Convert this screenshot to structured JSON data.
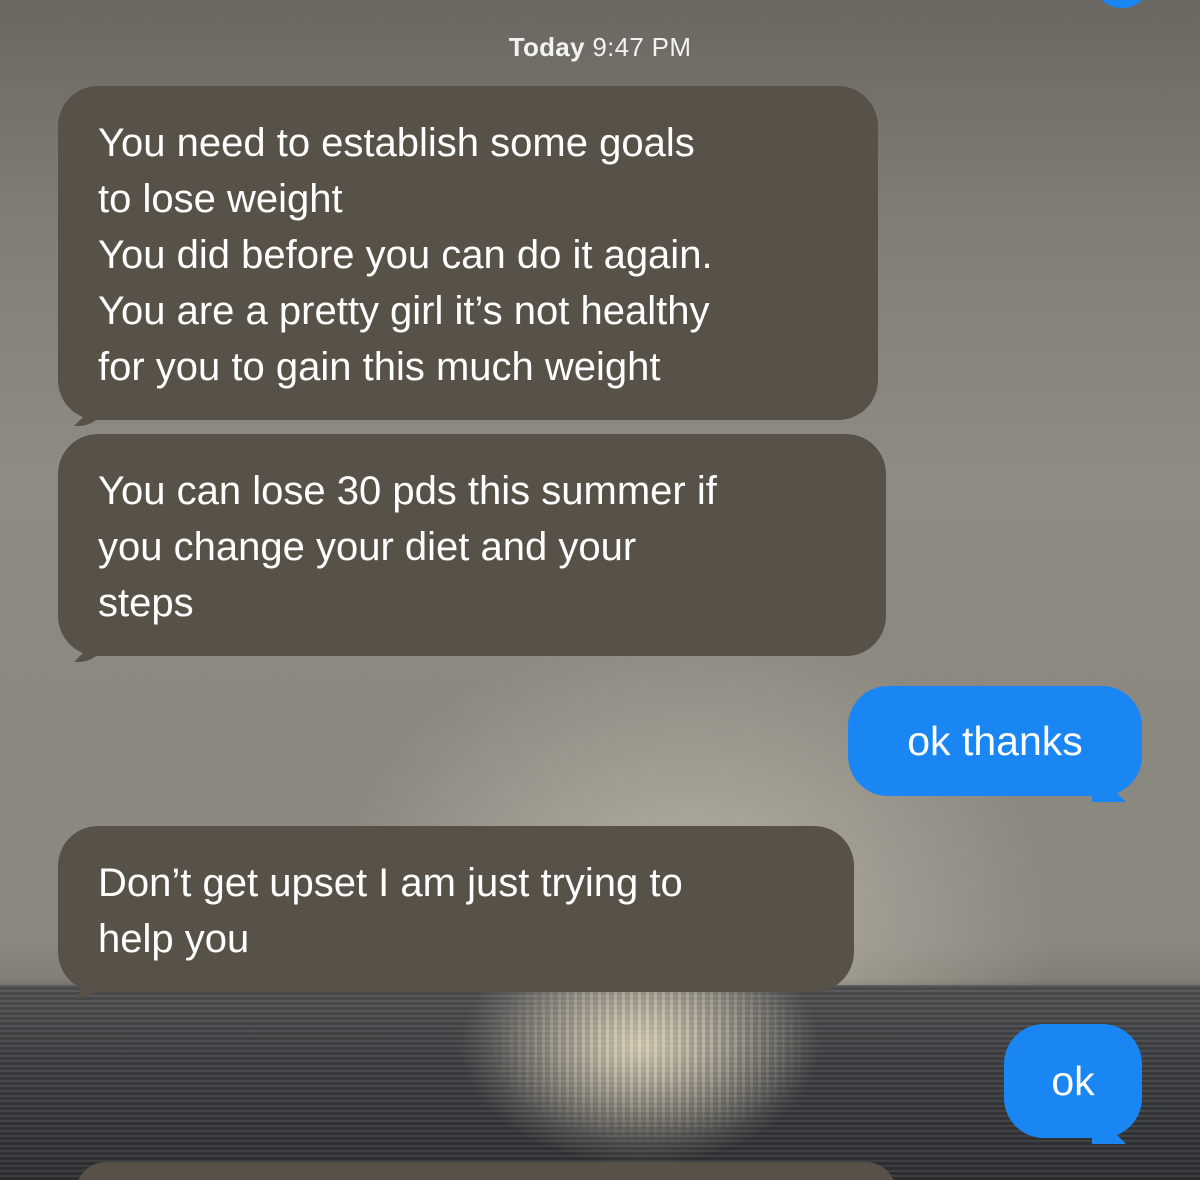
{
  "conversation": {
    "timestamp": {
      "day": "Today",
      "time": "9:47 PM"
    },
    "messages": [
      {
        "direction": "incoming",
        "text": "You need to establish some goals\nto lose weight\nYou did before you can do it again.\nYou are a pretty girl it’s not healthy\nfor you to gain this much weight"
      },
      {
        "direction": "incoming",
        "text": "You can lose 30 pds this summer if\nyou change your diet and your\nsteps"
      },
      {
        "direction": "outgoing",
        "text": "ok thanks"
      },
      {
        "direction": "incoming",
        "text": "Don’t get upset I am just trying to\nhelp you"
      },
      {
        "direction": "outgoing",
        "text": "ok"
      }
    ]
  },
  "colors": {
    "incoming_bubble": "#585148",
    "outgoing_bubble": "#1a86f4",
    "text": "#ffffff"
  }
}
